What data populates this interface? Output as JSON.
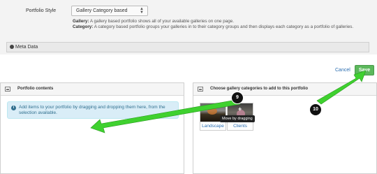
{
  "portfolio": {
    "style_label": "Portfolio Style",
    "style_value": "Gallery Category based",
    "help_gallery_label": "Gallery:",
    "help_gallery_text": " A gallery based portfolio shows all of your available galleries on one page.",
    "help_category_label": "Category:",
    "help_category_text": " A category based portfolio groups your galleries in to their category groups and then displays each category as a portfolio of galleries.",
    "meta_label": "Meta Data"
  },
  "actions": {
    "cancel_label": "Cancel",
    "save_label": "Save"
  },
  "left_panel": {
    "title": "Portfolio contents",
    "info_text": "Add items to your portfolio by dragging and dropping them here, from the selection available."
  },
  "right_panel": {
    "title": "Choose gallery categories to add to this portfolio",
    "categories": [
      {
        "label": "Landscape"
      },
      {
        "label": "Clients"
      }
    ],
    "tooltip": "Move by dragging"
  },
  "annotations": {
    "step_9": "9",
    "step_10": "10",
    "arrow_color": "#3fd12f"
  },
  "icons": [
    "chevron-updown-icon",
    "globe-icon",
    "picture-icon",
    "info-icon",
    "plus-icon"
  ]
}
